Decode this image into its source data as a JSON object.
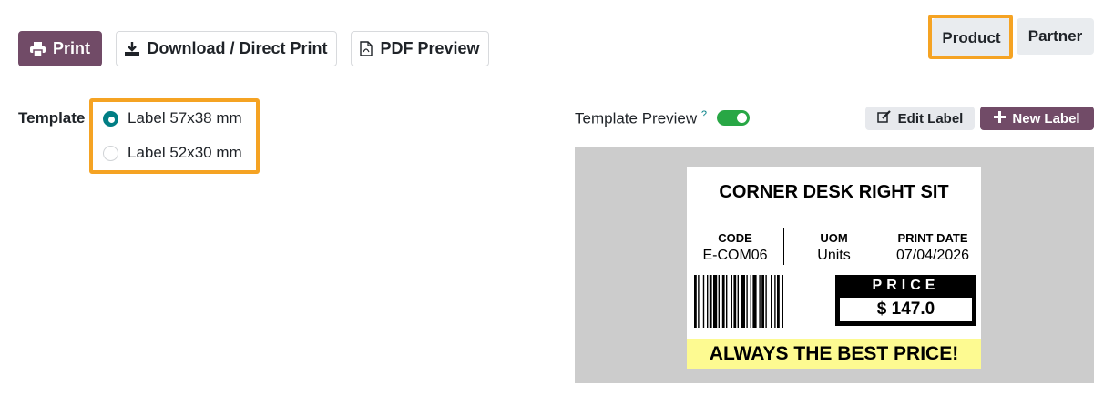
{
  "toolbar": {
    "print_label": "Print",
    "download_label": "Download / Direct Print",
    "pdf_label": "PDF Preview",
    "print_icon": "printer-icon",
    "download_icon": "download-icon",
    "pdf_icon": "pdf-file-icon"
  },
  "mode_switch": {
    "product_label": "Product",
    "partner_label": "Partner",
    "selected": "Product"
  },
  "template": {
    "field_label": "Template",
    "options": [
      {
        "label": "Label 57x38 mm",
        "checked": true
      },
      {
        "label": "Label 52x30 mm",
        "checked": false
      }
    ]
  },
  "preview": {
    "label": "Template Preview",
    "help_mark": "?",
    "toggle_on": true,
    "edit_label": "Edit Label",
    "new_label": "New Label",
    "edit_icon": "edit-icon",
    "new_icon": "plus-icon"
  },
  "label_card": {
    "title": "CORNER DESK RIGHT SIT",
    "columns": [
      {
        "header": "CODE",
        "value": "E-COM06"
      },
      {
        "header": "UOM",
        "value": "Units"
      },
      {
        "header": "PRINT DATE",
        "value": "07/04/2026"
      }
    ],
    "price_header": "PRICE",
    "price_value": "$ 147.0",
    "slogan": "ALWAYS THE BEST PRICE!",
    "slogan_color": "#fdfa91"
  },
  "colors": {
    "primary": "#714b67",
    "highlight": "#f5a323",
    "radio_checked": "#017e84",
    "toggle_on": "#28a745"
  }
}
